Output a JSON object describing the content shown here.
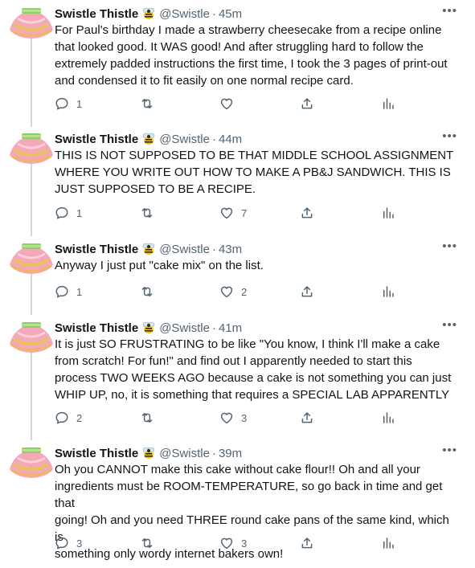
{
  "author": {
    "display_name": "Swistle Thistle",
    "handle": "@Swistle",
    "dot": "·"
  },
  "tweets": [
    {
      "time": "45m",
      "text": "For Paul's birthday I made a strawberry cheesecake from a recipe online\nthat looked good. It WAS good! And after struggling hard to follow the\nextremely padded instructions the first time, I took the 3 pages of print-out\nand condensed it to fit easily on one normal recipe card.",
      "replies": "1",
      "retweets": "",
      "likes": ""
    },
    {
      "time": "44m",
      "text": "THIS IS NOT SUPPOSED TO BE THAT MIDDLE SCHOOL ASSIGNMENT\nWHERE YOU WRITE OUT HOW TO MAKE A PB&J SANDWICH. THIS IS\nJUST SUPPOSED TO BE A RECIPE.",
      "replies": "1",
      "retweets": "",
      "likes": "7"
    },
    {
      "time": "43m",
      "text": "Anyway I just put \"cake mix\" on the list.",
      "replies": "1",
      "retweets": "",
      "likes": "2"
    },
    {
      "time": "41m",
      "text": "It is just SO FRUSTRATING to be like \"You know, I think I'll make a cake\nfrom scratch! For fun!\" and find out I apparently needed to start this\nprocess TWO WEEKS AGO because a cake is not something you can just\nWHIP UP, no, it is something that requires a SPECIAL LAB APPARENTLY",
      "replies": "2",
      "retweets": "",
      "likes": "3"
    },
    {
      "time": "39m",
      "text": "Oh you CANNOT make this cake without cake flour!! Oh and all your\ningredients must be ROOM-TEMPERATURE, so go back in time and get that\ngoing! Oh and you need THREE round cake pans of the same kind, which is\nsomething only wordy internet bakers own!",
      "replies": "3",
      "retweets": "",
      "likes": "3"
    }
  ],
  "icons": {
    "avatar": "tutu-avatar",
    "badge": "bee-emoji",
    "more": "more-dots-icon",
    "reply": "reply-icon",
    "retweet": "retweet-icon",
    "like": "like-icon",
    "share": "share-icon",
    "analytics": "analytics-icon"
  },
  "colors": {
    "text": "#0f1419",
    "secondary": "#536471",
    "thread_line": "#cfd9de"
  }
}
